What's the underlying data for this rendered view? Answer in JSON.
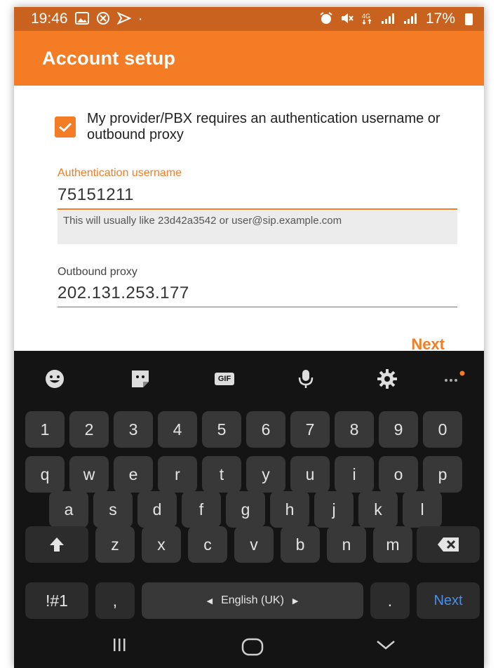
{
  "status_bar": {
    "time": "19:46",
    "battery": "17%",
    "dot": "·"
  },
  "app_bar": {
    "title": "Account setup"
  },
  "form": {
    "checkbox_label": "My provider/PBX requires an authentication username or outbound proxy",
    "checkbox_checked": true,
    "auth_label": "Authentication username",
    "auth_value": "75151211",
    "auth_hint": "This will usually like 23d42a3542 or user@sip.example.com",
    "proxy_label": "Outbound proxy",
    "proxy_value": "202.131.253.177",
    "next_label": "Next"
  },
  "keyboard": {
    "toolbar": [
      "emoji-icon",
      "sticker-icon",
      "gif-icon",
      "mic-icon",
      "settings-icon",
      "more-icon"
    ],
    "gif_label": "GIF",
    "number_row": [
      "1",
      "2",
      "3",
      "4",
      "5",
      "6",
      "7",
      "8",
      "9",
      "0"
    ],
    "row1": [
      "q",
      "w",
      "e",
      "r",
      "t",
      "y",
      "u",
      "i",
      "o",
      "p"
    ],
    "row2": [
      "a",
      "s",
      "d",
      "f",
      "g",
      "h",
      "j",
      "k",
      "l"
    ],
    "row3": [
      "z",
      "x",
      "c",
      "v",
      "b",
      "n",
      "m"
    ],
    "symbols_label": "!#1",
    "comma_label": ",",
    "space_label": "English (UK)",
    "period_label": ".",
    "enter_label": "Next"
  },
  "colors": {
    "accent": "#f47c24",
    "status_bar": "#c8621e",
    "keyboard_bg": "#141414",
    "key_bg": "#383838",
    "enter_text": "#4a8fe8"
  }
}
